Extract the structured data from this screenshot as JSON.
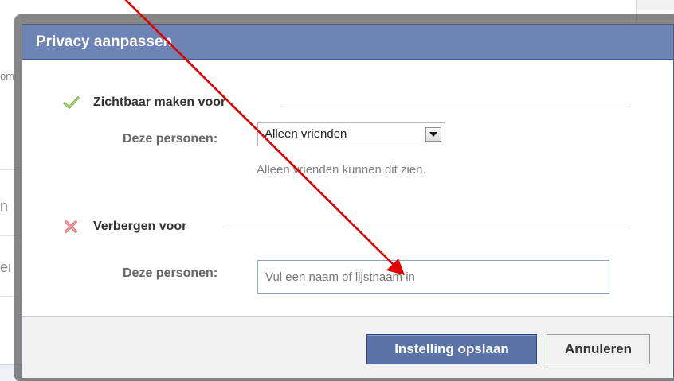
{
  "background": {
    "snippets": [
      "om",
      "n",
      "en"
    ]
  },
  "dialog": {
    "title": "Privacy aanpassen",
    "sections": [
      {
        "icon": "checkmark-icon",
        "title": "Zichtbaar maken voor",
        "field_label": "Deze personen:",
        "select_value": "Alleen vrienden",
        "help_text": "Alleen vrienden kunnen dit zien."
      },
      {
        "icon": "cross-icon",
        "title": "Verbergen voor",
        "field_label": "Deze personen:",
        "input_value": "",
        "input_placeholder": "Vul een naam of lijstnaam in"
      }
    ],
    "footer": {
      "save_label": "Instelling opslaan",
      "cancel_label": "Annuleren"
    }
  },
  "colors": {
    "header": "#6d84b4",
    "primary_button": "#5b74a8",
    "check": "#7cb342",
    "cross": "#e57373",
    "annotation_arrow": "#e00000"
  }
}
